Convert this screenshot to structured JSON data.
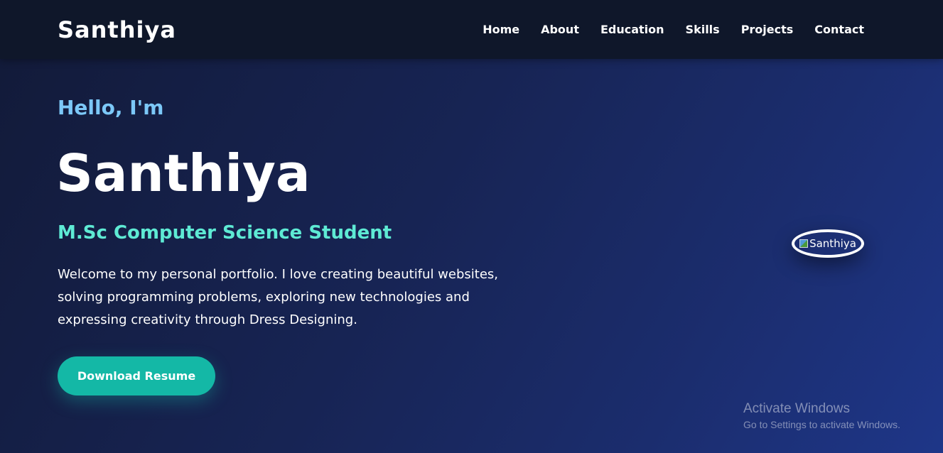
{
  "nav": {
    "logo": "Santhiya",
    "links": [
      "Home",
      "About",
      "Education",
      "Skills",
      "Projects",
      "Contact"
    ]
  },
  "hero": {
    "greeting": "Hello, I'm",
    "name": "Santhiya",
    "role": "M.Sc Computer Science Student",
    "intro": "Welcome to my personal portfolio. I love creating beautiful websites, solving programming problems, exploring new technologies and expressing creativity through Dress Designing.",
    "button_label": "Download Resume",
    "image_alt": "Santhiya"
  },
  "watermark": {
    "title": "Activate Windows",
    "subtitle": "Go to Settings to activate Windows."
  },
  "colors": {
    "nav_bg": "#0f172a",
    "accent_teal": "#14b8a6",
    "greeting_blue": "#7cc8f8",
    "role_teal": "#5eead4"
  }
}
